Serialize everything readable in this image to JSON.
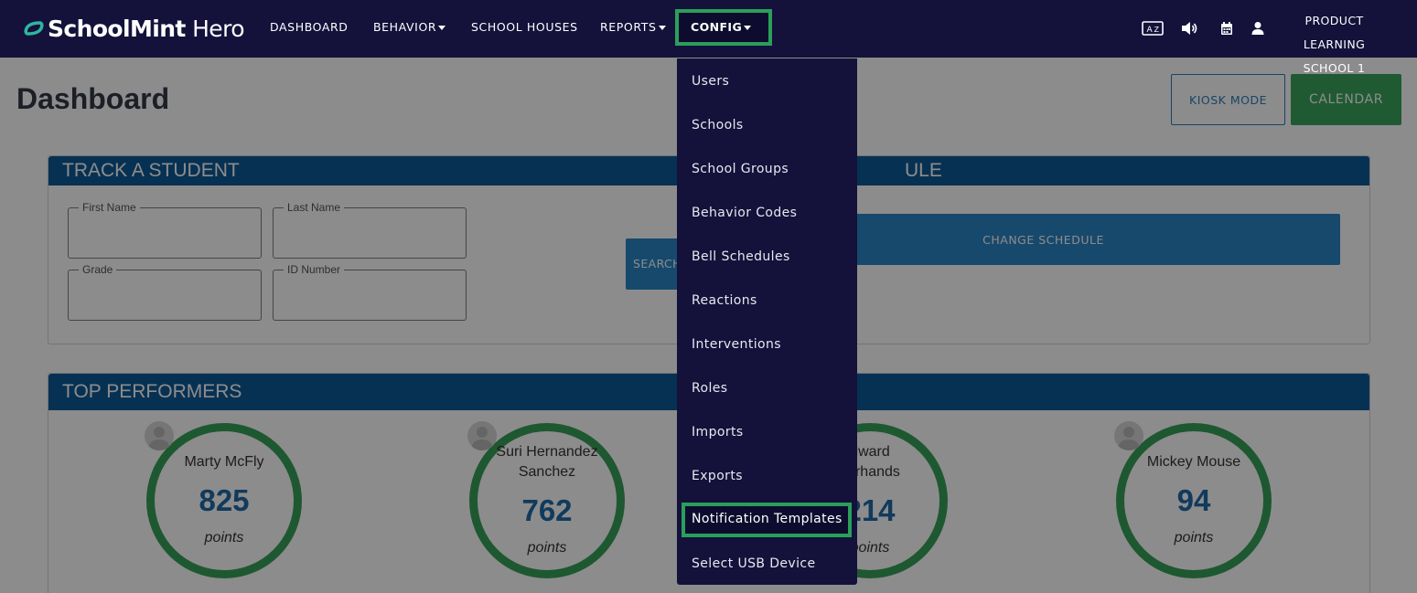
{
  "header": {
    "logo_bold": "SchoolMint",
    "logo_light": " Hero",
    "nav": {
      "dashboard": "DASHBOARD",
      "behavior": "BEHAVIOR",
      "school_houses": "SCHOOL HOUSES",
      "reports": "REPORTS",
      "config": "CONFIG"
    },
    "icons": [
      "language-icon",
      "speaker-icon",
      "calendar-icon",
      "user-icon"
    ],
    "user_line1": "PRODUCT LEARNING",
    "user_line2": "SCHOOL 1"
  },
  "page": {
    "title": "Dashboard",
    "kiosk_label": "KIOSK MODE",
    "calendar_label": "CALENDAR"
  },
  "track": {
    "heading": "TRACK A STUDENT",
    "fields": {
      "first_name": "First Name",
      "last_name": "Last Name",
      "grade": "Grade",
      "id_number": "ID Number"
    },
    "search_label": "SEARCH"
  },
  "schedule": {
    "heading_visible": "ULE",
    "change_label": "CHANGE SCHEDULE"
  },
  "top_performers": {
    "heading": "TOP PERFORMERS",
    "unit": "points",
    "people": [
      {
        "name": "Marty McFly",
        "points": "825"
      },
      {
        "name": "Suri Hernandez Sanchez",
        "line1": "Suri Hernandez",
        "line2": "Sanchez",
        "points": "762"
      },
      {
        "line1": "dward",
        "line2": "sorhands",
        "points": "214"
      },
      {
        "name": "Mickey Mouse",
        "points": "94"
      }
    ]
  },
  "config_menu": {
    "items": [
      "Users",
      "Schools",
      "School Groups",
      "Behavior Codes",
      "Bell Schedules",
      "Reactions",
      "Interventions",
      "Roles",
      "Imports",
      "Exports",
      "Notification Templates",
      "Select USB Device"
    ],
    "highlighted": "Notification Templates"
  },
  "colors": {
    "nav_bg": "#14113b",
    "highlight": "#2b9f5a",
    "card_header": "#0d5a97",
    "button_blue": "#2b86c5",
    "calendar_green": "#3aa55d",
    "ring_green": "#37a059",
    "points_blue": "#1f6aa8"
  }
}
